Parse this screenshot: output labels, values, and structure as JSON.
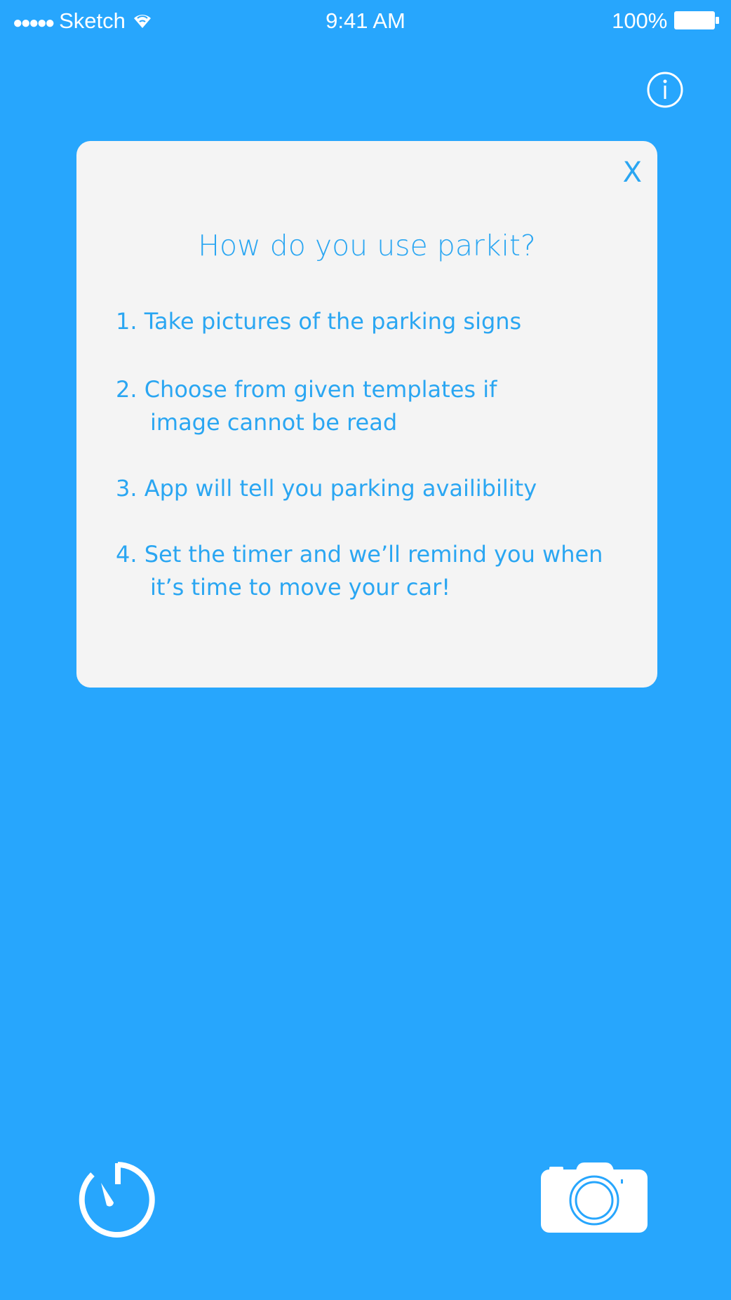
{
  "status_bar": {
    "carrier": "Sketch",
    "time": "9:41 AM",
    "battery": "100%",
    "signal_icon": "signal-dots-icon",
    "wifi_icon": "wifi-icon",
    "battery_icon": "battery-icon"
  },
  "header": {
    "info_icon": "info-icon"
  },
  "modal": {
    "close_label": "X",
    "title": "How do you use parkit?",
    "steps": [
      {
        "line1": "1. Take pictures of the parking signs",
        "line2": ""
      },
      {
        "line1": "2. Choose from given templates if",
        "line2": "image cannot be read"
      },
      {
        "line1": "3. App will tell you parking availibility",
        "line2": ""
      },
      {
        "line1": "4. Set the timer and we’ll remind you when",
        "line2": "it’s time to move your car!"
      }
    ]
  },
  "bottom_bar": {
    "timer_icon": "timer-icon",
    "camera_icon": "camera-icon"
  },
  "colors": {
    "background": "#27a6fd",
    "card": "#f4f4f4",
    "accent_text": "#2aa6f2"
  }
}
